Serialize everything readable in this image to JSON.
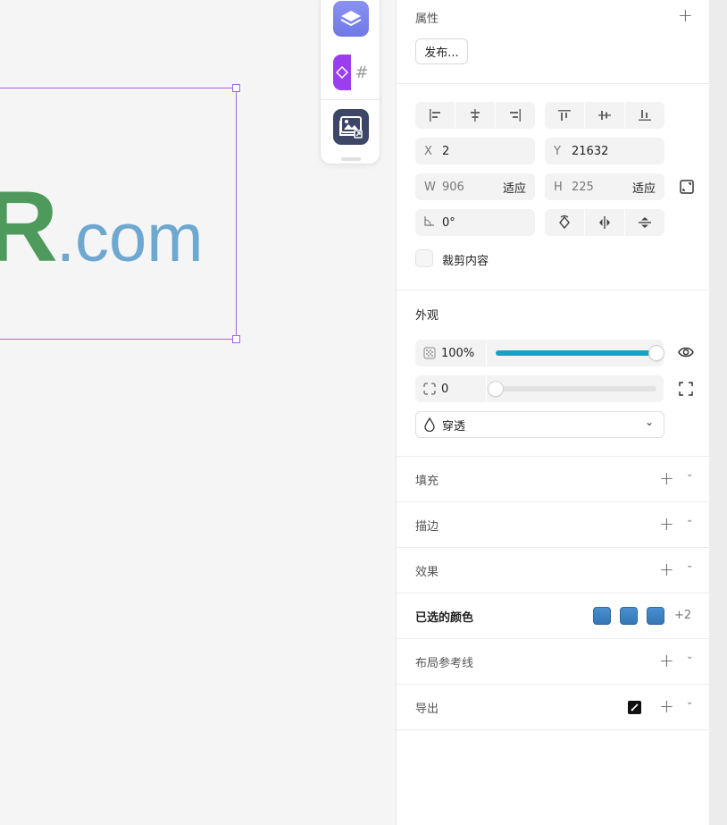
{
  "canvas": {
    "logo_main": "R",
    "logo_suffix": ".com"
  },
  "toolbar": {
    "hash_glyph": "#"
  },
  "properties": {
    "title": "属性",
    "publish_label": "发布..."
  },
  "transform": {
    "x_label": "X",
    "x_value": "2",
    "y_label": "Y",
    "y_value": "21632",
    "w_label": "W",
    "w_value": "906",
    "w_fit": "适应",
    "h_label": "H",
    "h_value": "225",
    "h_fit": "适应",
    "rotation_value": "0°",
    "clip_label": "裁剪内容"
  },
  "appearance": {
    "title": "外观",
    "opacity_value": "100%",
    "opacity_fraction": 1.0,
    "radius_value": "0",
    "radius_fraction": 0.0,
    "blend_mode": "穿透",
    "accent_color": "#13a4c3"
  },
  "sections": {
    "fill": "填充",
    "stroke": "描边",
    "effects": "效果",
    "selected_colors": "已选的颜色",
    "selected_colors_more": "+2",
    "layout_guides": "布局参考线",
    "export": "导出"
  },
  "colors": {
    "selection": "#a564e8",
    "logo_green": "#4e9a5c",
    "logo_blue": "#6ea7cf",
    "swatch_blue": "#3b7fc1"
  },
  "icons": {
    "plus": "+",
    "chevron": "⌄"
  }
}
